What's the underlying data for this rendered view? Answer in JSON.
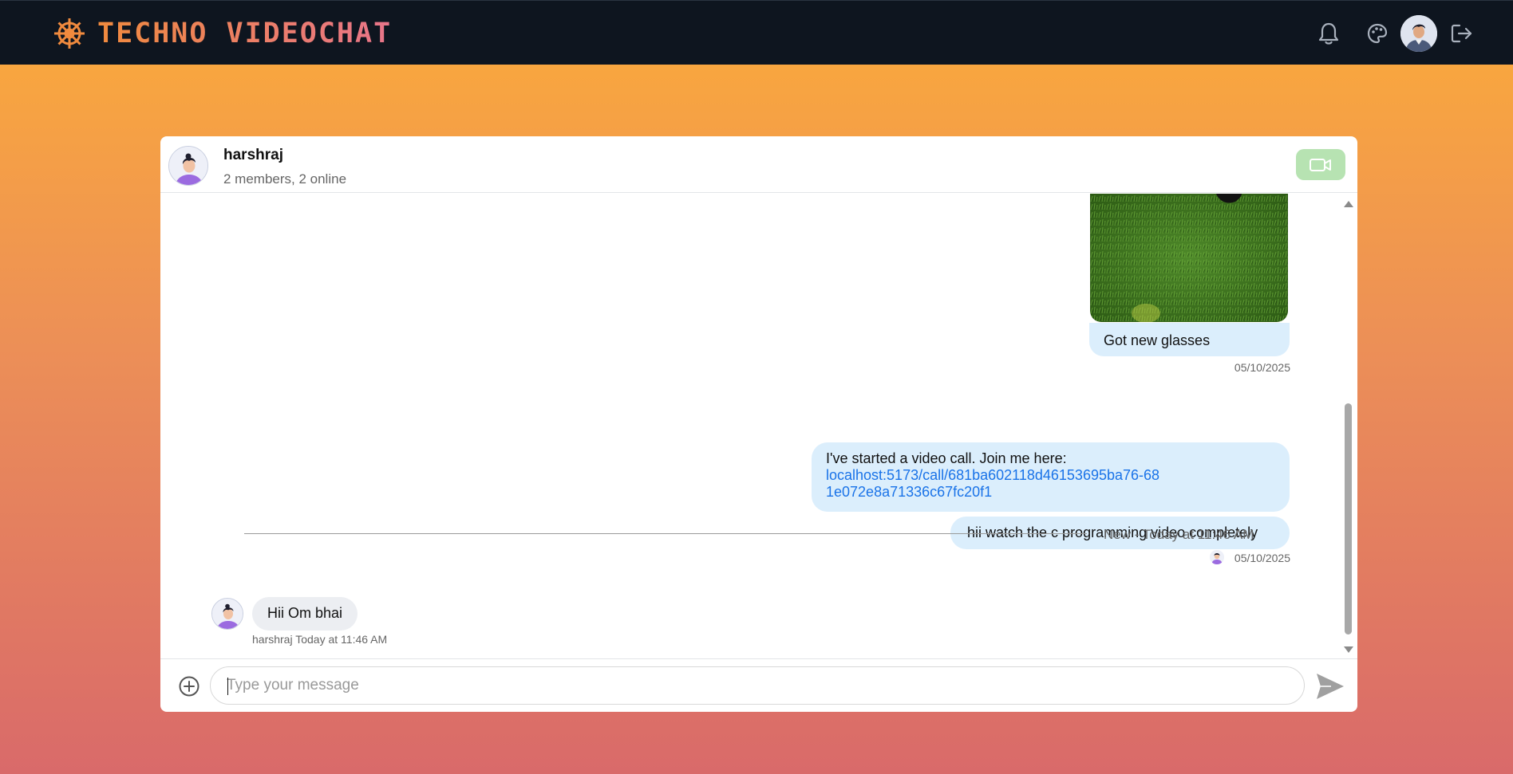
{
  "app": {
    "title": "TECHNO VIDEOCHAT",
    "logo_icon": "ship-wheel-icon",
    "nav_icons": [
      "bell-icon",
      "palette-icon",
      "avatar",
      "logout-icon"
    ]
  },
  "colors": {
    "nav_bg": "#0e151f",
    "brand_gradient": [
      "#f08a3e",
      "#e8758a"
    ],
    "outgoing_bubble": "#dbeefc",
    "incoming_bubble": "#eceef2",
    "video_button": "#b7e3b2",
    "link": "#1a73e8"
  },
  "chat": {
    "name": "harshraj",
    "subtitle": "2 members, 2 online",
    "video_button_icon": "video-camera-icon"
  },
  "messages": {
    "image_caption": "Got new glasses",
    "image_date": "05/10/2025",
    "call_text": "I've started a video call. Join me here:",
    "call_link": "localhost:5173/call/681ba602118d46153695ba76-681e072e8a71336c67fc20f1",
    "watch_text": "hii watch the c programming video completely",
    "watch_date": "05/10/2025",
    "new_divider": "New - Today at 11:46 AM",
    "incoming_text": "Hii Om bhai",
    "incoming_sender": "harshraj",
    "incoming_time": "Today at 11:46 AM"
  },
  "composer": {
    "placeholder": "Type your message",
    "value": "",
    "attach_icon": "plus-circle-icon",
    "send_icon": "send-icon"
  }
}
